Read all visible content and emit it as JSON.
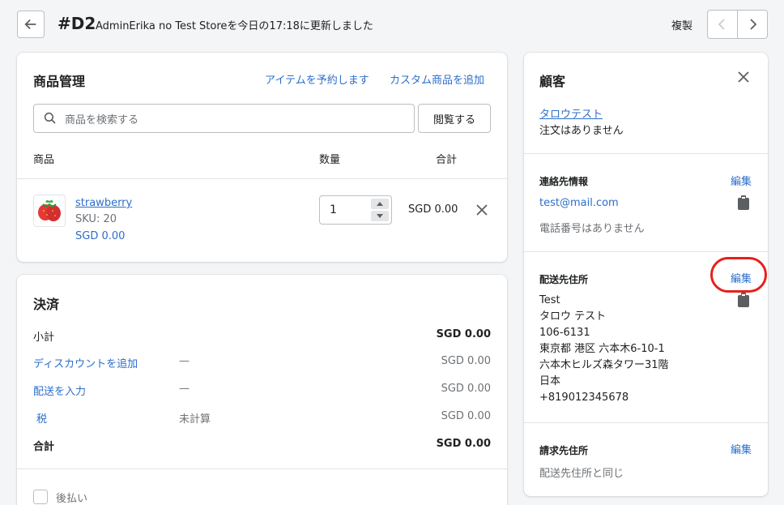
{
  "header": {
    "order_id": "#D2",
    "subtitle": "AdminErika no Test Storeを今日の17:18に更新しました",
    "duplicate": "複製"
  },
  "products": {
    "title": "商品管理",
    "reserve_link": "アイテムを予約します",
    "custom_link": "カスタム商品を追加",
    "search_placeholder": "商品を検索する",
    "browse": "閲覧する",
    "col_product": "商品",
    "col_qty": "数量",
    "col_total": "合計",
    "item": {
      "name": "strawberry",
      "sku": "SKU: 20",
      "price": "SGD 0.00",
      "qty": "1",
      "total": "SGD 0.00"
    }
  },
  "payment": {
    "title": "決済",
    "subtotal_label": "小計",
    "subtotal": "SGD 0.00",
    "discount_label": "ディスカウントを追加",
    "discount_mid": "—",
    "discount": "SGD 0.00",
    "shipping_label": "配送を入力",
    "shipping_mid": "—",
    "shipping": "SGD 0.00",
    "tax_label": "税",
    "tax_mid": "未計算",
    "tax": "SGD 0.00",
    "total_label": "合計",
    "total": "SGD 0.00",
    "pay_later": "後払い"
  },
  "customer": {
    "title": "顧客",
    "name": "タロウテスト",
    "orders": "注文はありません",
    "contact_title": "連絡先情報",
    "contact_edit": "編集",
    "email": "test@mail.com",
    "phone": "電話番号はありません",
    "shipping_title": "配送先住所",
    "shipping_edit": "編集",
    "address": [
      "Test",
      "タロウ テスト",
      "106-6131",
      "東京都 港区 六本木6-10-1",
      "六本木ヒルズ森タワー31階",
      "日本",
      "+819012345678"
    ],
    "billing_title": "請求先住所",
    "billing_edit": "編集",
    "billing_same": "配送先住所と同じ"
  }
}
